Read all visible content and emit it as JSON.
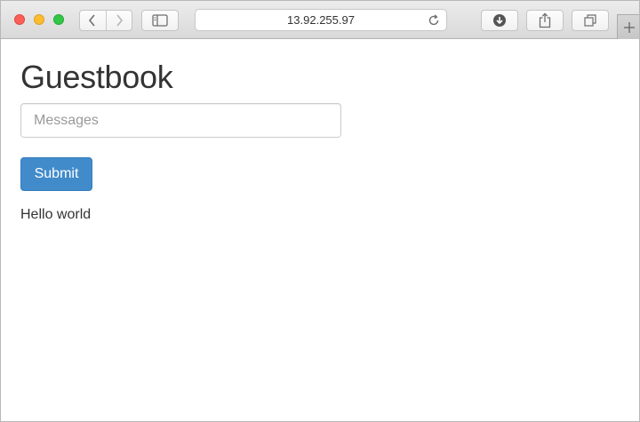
{
  "browser": {
    "address": "13.92.255.97",
    "icons": {
      "back": "chevron-left-icon",
      "forward": "chevron-right-icon",
      "sidebar": "sidebar-icon",
      "reload": "reload-icon",
      "downloads": "download-icon",
      "share": "share-icon",
      "tabs": "tabs-icon",
      "new_tab": "plus-icon"
    }
  },
  "page": {
    "title": "Guestbook",
    "input_placeholder": "Messages",
    "input_value": "",
    "submit_label": "Submit",
    "entries": [
      "Hello world"
    ]
  },
  "colors": {
    "button_primary": "#428bca",
    "traffic_close": "#fc5f57",
    "traffic_min": "#fdbc2e",
    "traffic_max": "#33c748"
  }
}
